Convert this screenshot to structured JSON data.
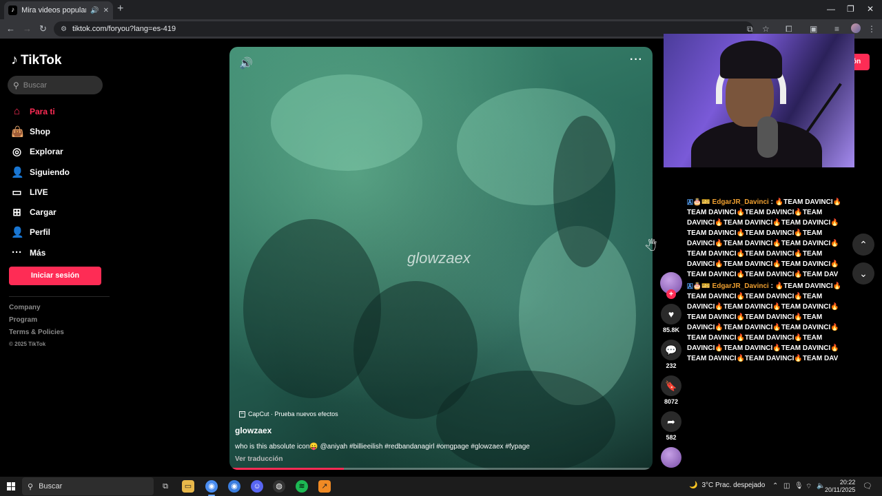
{
  "browser": {
    "tab_title": "Mira videos populares sele",
    "url": "tiktok.com/foryou?lang=es-419",
    "new_tab": "+",
    "minimize": "—",
    "restore": "❐",
    "close": "✕"
  },
  "sidebar": {
    "logo": "TikTok",
    "search_placeholder": "Buscar",
    "items": [
      {
        "label": "Para ti",
        "icon": "home-icon"
      },
      {
        "label": "Shop",
        "icon": "shop-icon"
      },
      {
        "label": "Explorar",
        "icon": "compass-icon"
      },
      {
        "label": "Siguiendo",
        "icon": "following-icon"
      },
      {
        "label": "LIVE",
        "icon": "live-icon"
      },
      {
        "label": "Cargar",
        "icon": "upload-icon"
      },
      {
        "label": "Perfil",
        "icon": "profile-icon"
      },
      {
        "label": "Más",
        "icon": "more-icon"
      }
    ],
    "login": "Iniciar sesión",
    "footer": [
      "Company",
      "Program",
      "Terms & Policies",
      "© 2025 TikTok"
    ]
  },
  "video": {
    "watermark": "glowzaex",
    "capcut": "CapCut · Prueba nuevos efectos",
    "author": "glowzaex",
    "description": "who is this absolute icon😛 @aniyah #billieeilish #redbandanagirl #omgpage #glowzaex #fypage",
    "translate": "Ver traducción",
    "progress": 0.27
  },
  "actions": {
    "likes": "85.8K",
    "comments": "232",
    "saves": "8072",
    "shares": "582"
  },
  "header_login_partial": "ón",
  "chat": [
    {
      "badges": "🇦🎂🎫",
      "user": "EdgarJR_Davinci",
      "text": ": 🔥TEAM DAVINCI🔥TEAM DAVINCI🔥TEAM DAVINCI🔥TEAM DAVINCI🔥TEAM DAVINCI🔥TEAM DAVINCI🔥TEAM DAVINCI🔥TEAM DAVINCI🔥TEAM DAVINCI🔥TEAM DAVINCI🔥TEAM DAVINCI🔥TEAM DAVINCI🔥TEAM DAVINCI🔥TEAM DAVINCI🔥TEAM DAVINCI🔥TEAM DAVINCI🔥TEAM DAVINCI🔥TEAM DAVINCI🔥TEAM DAV"
    },
    {
      "badges": "🇦🎂🎫",
      "user": "EdgarJR_Davinci",
      "text": ": 🔥TEAM DAVINCI🔥TEAM DAVINCI🔥TEAM DAVINCI🔥TEAM DAVINCI🔥TEAM DAVINCI🔥TEAM DAVINCI🔥TEAM DAVINCI🔥TEAM DAVINCI🔥TEAM DAVINCI🔥TEAM DAVINCI🔥TEAM DAVINCI🔥TEAM DAVINCI🔥TEAM DAVINCI🔥TEAM DAVINCI🔥TEAM DAVINCI🔥TEAM DAVINCI🔥TEAM DAVINCI🔥TEAM DAVINCI🔥TEAM DAV"
    }
  ],
  "taskbar": {
    "search": "Buscar",
    "weather": "3°C  Prac. despejado",
    "time": "20:22",
    "date": "20/11/2025"
  },
  "colors": {
    "accent": "#fe2c55",
    "chat_user": "#f0a030"
  }
}
